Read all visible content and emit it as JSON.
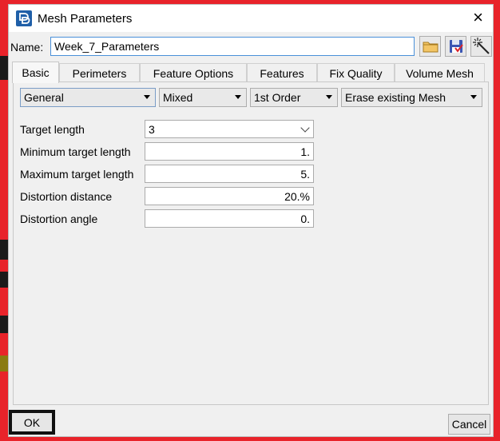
{
  "window": {
    "title": "Mesh Parameters",
    "close_glyph": "×",
    "icon": "app-logo-icon"
  },
  "name_row": {
    "label": "Name:",
    "value": "Week_7_Parameters",
    "tools": [
      {
        "name": "open-folder-icon",
        "color": "#e7b44b"
      },
      {
        "name": "save-disk-icon",
        "color": "#3b56b3"
      },
      {
        "name": "magic-wand-icon",
        "color": "#222222"
      }
    ]
  },
  "tabs": [
    "Basic",
    "Perimeters",
    "Feature Options",
    "Features",
    "Fix Quality",
    "Volume Mesh"
  ],
  "active_tab": "Basic",
  "dropdowns": [
    "General",
    "Mixed",
    "1st Order",
    "Erase existing Mesh"
  ],
  "params": [
    {
      "label": "Target length",
      "value": "3"
    },
    {
      "label": "Minimum target length",
      "value": "1."
    },
    {
      "label": "Maximum target length",
      "value": "5."
    },
    {
      "label": "Distortion distance",
      "value": "20.%"
    },
    {
      "label": "Distortion angle",
      "value": "0."
    }
  ],
  "buttons": {
    "ok": "OK",
    "cancel": "Cancel"
  },
  "colors": {
    "background": "#e8232a",
    "dialog": "#f0f0f0",
    "accent": "#4a90d9"
  }
}
